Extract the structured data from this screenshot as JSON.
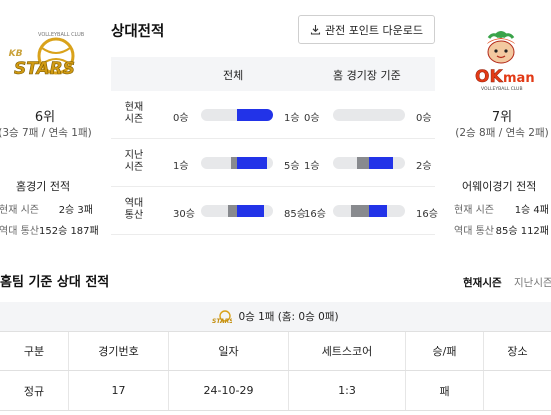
{
  "left_team": {
    "logo_text": "KB STARS",
    "logo_subtext": "VOLLEYBALL CLUB",
    "rank": "6위",
    "record": "(3승 7패 / 연속 1패)",
    "side_title": "홈경기 전적",
    "rows": [
      {
        "label": "현재 시즌",
        "value": "2승 3패"
      },
      {
        "label": "역대 통산",
        "value": "152승 187패"
      }
    ]
  },
  "right_team": {
    "logo_text": "OKman",
    "logo_subtext": "VOLLEYBALL CLUB",
    "rank": "7위",
    "record": "(2승 8패 / 연속 2패)",
    "side_title": "어웨이경기 전적",
    "rows": [
      {
        "label": "현재 시즌",
        "value": "1승 4패"
      },
      {
        "label": "역대 통산",
        "value": "85승 112패"
      }
    ]
  },
  "center": {
    "title": "상대전적",
    "download_label": "관전 포인트 다운로드",
    "col_all": "전체",
    "col_home": "홈 경기장 기준",
    "rows": [
      {
        "label": "현재\n시즌",
        "all_left": "0승",
        "all_right": "1승",
        "home_left": "0승",
        "home_right": "0승",
        "all_fill": 1.0,
        "home_fill": 0.0
      },
      {
        "label": "지난\n시즌",
        "all_left": "1승",
        "all_right": "5승",
        "home_left": "1승",
        "home_right": "2승",
        "all_fill": 0.83,
        "home_fill": 0.67
      },
      {
        "label": "역대\n통산",
        "all_left": "30승",
        "all_right": "85승",
        "home_left": "16승",
        "home_right": "16승",
        "all_fill": 0.74,
        "home_fill": 0.5
      }
    ],
    "colors": {
      "blue": "#2233e8",
      "gray": "#888a8e",
      "track": "#e7e8ea"
    }
  },
  "bottom": {
    "title": "홈팀 기준 상대 전적",
    "tab_current": "현재시즌",
    "tab_last": "지난시즌",
    "summary": "0승 1패 (홈: 0승 0패)",
    "headers": [
      "구분",
      "경기번호",
      "일자",
      "세트스코어",
      "승/패",
      "장소"
    ],
    "rows": [
      [
        "정규",
        "17",
        "24-10-29",
        "1:3",
        "패",
        ""
      ]
    ]
  }
}
